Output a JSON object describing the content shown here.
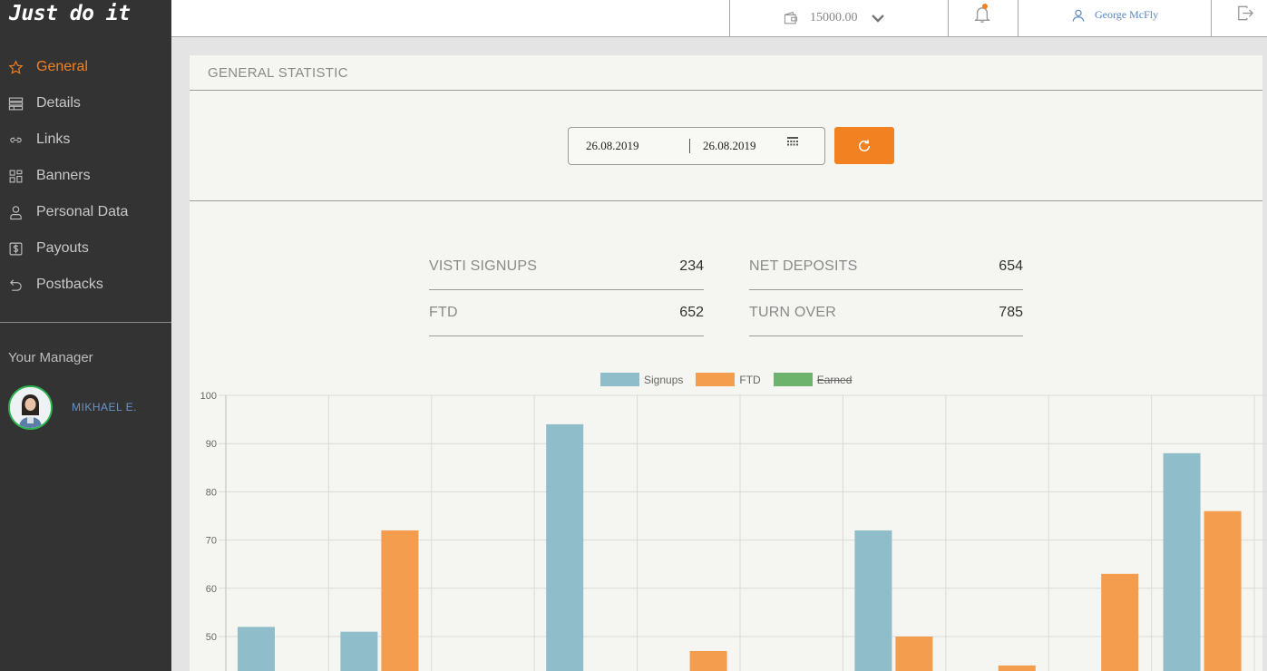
{
  "app": {
    "logo": "Just do it"
  },
  "sidebar": {
    "items": [
      {
        "label": "General",
        "icon": "star-icon",
        "active": true
      },
      {
        "label": "Details",
        "icon": "details-icon",
        "active": false
      },
      {
        "label": "Links",
        "icon": "link-icon",
        "active": false
      },
      {
        "label": "Banners",
        "icon": "banners-icon",
        "active": false
      },
      {
        "label": "Personal Data",
        "icon": "user-icon",
        "active": false
      },
      {
        "label": "Payouts",
        "icon": "dollar-icon",
        "active": false
      },
      {
        "label": "Postbacks",
        "icon": "return-icon",
        "active": false
      }
    ],
    "manager_title": "Your Manager",
    "manager_name": "MIKHAEL E."
  },
  "topbar": {
    "balance": "15000.00",
    "user_name": "George McFly"
  },
  "panel": {
    "title": "GENERAL STATISTIC",
    "date_from": "26.08.2019",
    "date_to": "26.08.2019"
  },
  "stats": [
    {
      "label": "VISTI SIGNUPS",
      "value": "234"
    },
    {
      "label": "NET DEPOSITS",
      "value": "654"
    },
    {
      "label": "FTD",
      "value": "652"
    },
    {
      "label": "TURN OVER",
      "value": "785"
    }
  ],
  "colors": {
    "accent": "#f28121",
    "signups": "#8fbdc9",
    "ftd": "#f49d4f",
    "earned": "#6db26d"
  },
  "chart_data": {
    "type": "bar",
    "categories": [
      "",
      "",
      "",
      "",
      "",
      "",
      "",
      "",
      "",
      ""
    ],
    "series": [
      {
        "name": "Signups",
        "values": [
          52,
          51,
          0,
          94,
          0,
          0,
          72,
          0,
          0,
          88
        ]
      },
      {
        "name": "FTD",
        "values": [
          0,
          72,
          0,
          0,
          47,
          0,
          50,
          44,
          63,
          76
        ]
      },
      {
        "name": "Earned",
        "values": [],
        "hidden": true
      }
    ],
    "yticks": [
      "100",
      "90",
      "80",
      "70",
      "60",
      "50"
    ],
    "ylim": [
      0,
      100
    ],
    "grid": true,
    "legend": "top-center"
  }
}
